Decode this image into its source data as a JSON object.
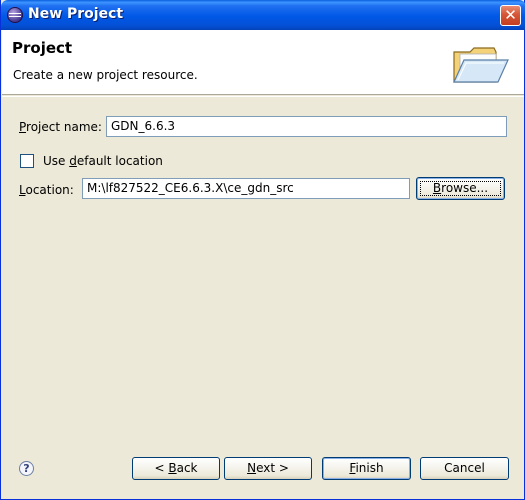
{
  "window": {
    "title": "New Project",
    "close_glyph": "✕"
  },
  "header": {
    "title": "Project",
    "description": "Create a new project resource.",
    "icon": "open-folder-icon"
  },
  "form": {
    "project_name": {
      "label_mnemonic": "P",
      "label_rest": "roject name:",
      "value": "GDN_6.6.3"
    },
    "use_default": {
      "label_pre": "Use ",
      "label_mnemonic": "d",
      "label_rest": "efault location",
      "checked": false
    },
    "location": {
      "label_pre": "",
      "label_mnemonic": "L",
      "label_rest": "ocation:",
      "value": "M:\\lf827522_CE6.6.3.X\\ce_gdn_src"
    },
    "browse_button": {
      "label_pre": "",
      "label_mnemonic": "B",
      "label_rest": "rowse..."
    }
  },
  "footer": {
    "help_glyph": "?",
    "back": {
      "label_pre": "< ",
      "label_mnemonic": "B",
      "label_rest": "ack"
    },
    "next": {
      "label_pre": "",
      "label_mnemonic": "N",
      "label_rest": "ext >"
    },
    "finish": {
      "label_pre": "",
      "label_mnemonic": "F",
      "label_rest": "inish"
    },
    "cancel": {
      "label": "Cancel"
    }
  },
  "colors": {
    "titlebar": "#0058e6",
    "dialog_bg": "#ece9d8",
    "button_border": "#003c74"
  }
}
